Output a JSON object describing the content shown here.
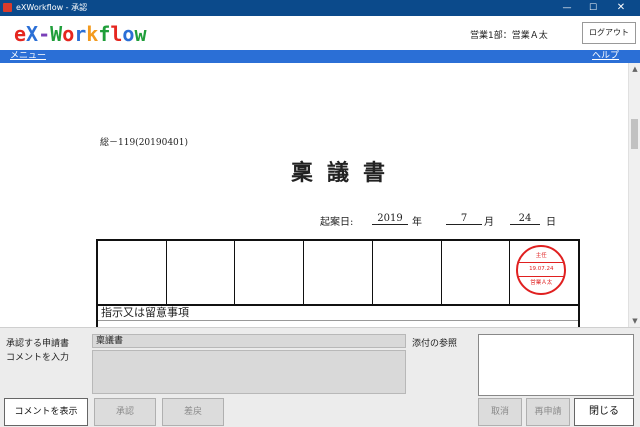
{
  "window": {
    "title": "eXWorkflow - 承認",
    "controls": {
      "minimize": "—",
      "maximize": "☐",
      "close": "✕"
    }
  },
  "header": {
    "logo_letters": [
      {
        "char": "e",
        "color": "#e5261f"
      },
      {
        "char": "X",
        "color": "#2b6fd6"
      },
      {
        "char": "-",
        "color": "#7a3fb8"
      },
      {
        "char": "W",
        "color": "#1f9e3a"
      },
      {
        "char": "o",
        "color": "#e5261f"
      },
      {
        "char": "r",
        "color": "#2b6fd6"
      },
      {
        "char": "k",
        "color": "#f39a1e"
      },
      {
        "char": "f",
        "color": "#1f9e3a"
      },
      {
        "char": "l",
        "color": "#e5261f"
      },
      {
        "char": "o",
        "color": "#2b6fd6"
      },
      {
        "char": "w",
        "color": "#1f9e3a"
      }
    ],
    "user_dept": "営業1部：営業Ａ太",
    "logout_label": "ログアウト"
  },
  "menubar": {
    "menu_label": "メニュー",
    "help_label": "ヘルプ"
  },
  "document": {
    "code": "総－119(20190401)",
    "title": "稟議書",
    "date": {
      "label": "起案日:",
      "year": "2019",
      "year_unit": "年",
      "month": "7",
      "month_unit": "月",
      "day": "24",
      "day_unit": "日"
    },
    "stamp": {
      "role": "主任",
      "date": "19.07.24",
      "name": "営業Ａ太"
    },
    "instructions_label": "指示又は留意事項"
  },
  "bottom": {
    "approve_label": "承認する申請書",
    "comment_label": "コメントを入力",
    "attach_label": "添付の参照",
    "form_name": "稟議書",
    "comment_value": "",
    "buttons": {
      "show_comment": "コメントを表示",
      "approve": "承認",
      "reject": "差戻",
      "cancel": "取消",
      "reapply": "再申請",
      "close": "閉じる"
    }
  },
  "colors": {
    "titlebar": "#0b4a8b",
    "menubar": "#2b6fd6",
    "stamp": "#e02020"
  }
}
